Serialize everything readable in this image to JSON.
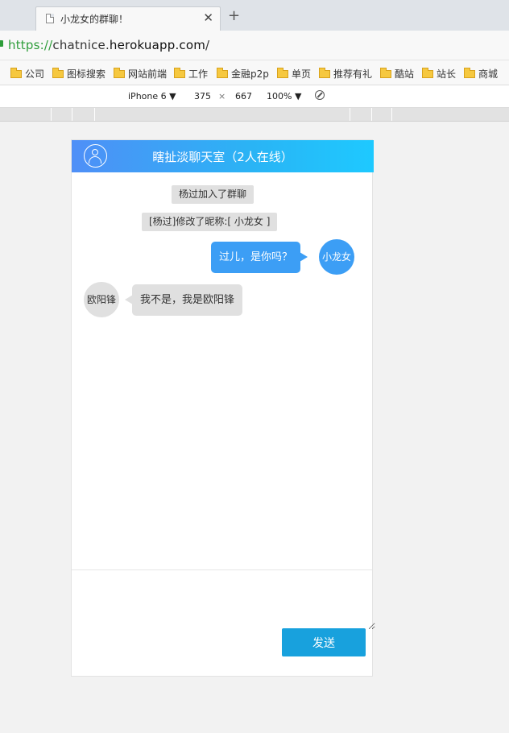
{
  "browser": {
    "tab_title": "小龙女的群聊！",
    "tab_close": "✕",
    "new_tab": "+",
    "url_protocol": "https://",
    "url_sub": "chatnice.",
    "url_host": "herokuapp.com",
    "url_path": "/",
    "bookmarks": [
      "公司",
      "图标搜索",
      "网站前端",
      "工作",
      "金融p2p",
      "单页",
      "推荐有礼",
      "酷站",
      "站长",
      "商城"
    ]
  },
  "device_toolbar": {
    "device": "iPhone 6 ▼",
    "width": "375",
    "times": "×",
    "height": "667",
    "zoom": "100% ▼"
  },
  "chat": {
    "title": "瞎扯淡聊天室（2人在线）",
    "system_messages": [
      "杨过加入了群聊",
      "[杨过]修改了昵称:[ 小龙女 ]"
    ],
    "messages": [
      {
        "sender": "小龙女",
        "text": "过儿，是你吗？",
        "self": true
      },
      {
        "sender": "欧阳锋",
        "text": "我不是，我是欧阳锋",
        "self": false
      }
    ],
    "send_label": "发送"
  },
  "colors": {
    "header_start": "#4f8ff7",
    "header_end": "#1ec9ff",
    "self_bubble": "#3c9ef5",
    "other_bubble": "#e0e0e0",
    "send_button": "#18a1dd"
  }
}
